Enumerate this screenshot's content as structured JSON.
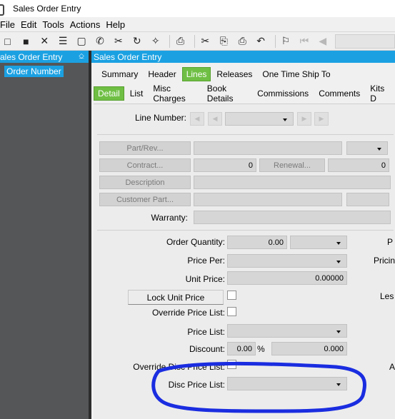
{
  "window": {
    "title": "Sales Order Entry"
  },
  "menu": [
    "File",
    "Edit",
    "Tools",
    "Actions",
    "Help"
  ],
  "toolbar": {
    "icons": [
      "new-icon",
      "save-icon",
      "delete-icon",
      "book-icon",
      "note-icon",
      "phone-icon",
      "attach-icon",
      "refresh-icon",
      "clear-icon",
      "print-icon",
      "cut-icon",
      "copy-icon",
      "paste-icon",
      "undo-icon",
      "binoculars-icon",
      "first-record-icon",
      "previous-record-icon"
    ],
    "glyphs": [
      "□",
      "■",
      "✕",
      "☰",
      "▢",
      "✆",
      "✂",
      "↻",
      "✧",
      "⎙",
      "✂",
      "⎘",
      "⎙",
      "↶",
      "⚐",
      "⏮",
      "◀"
    ]
  },
  "tree": {
    "header": "ales Order Entry",
    "pin": "⎐",
    "node": "Order Number"
  },
  "main": {
    "header": "Sales Order Entry",
    "tabs_top": [
      {
        "label": "Summary",
        "active": false
      },
      {
        "label": "Header",
        "active": false
      },
      {
        "label": "Lines",
        "active": true
      },
      {
        "label": "Releases",
        "active": false
      },
      {
        "label": "One Time Ship To",
        "active": false
      }
    ],
    "tabs_sub": [
      {
        "label": "Detail",
        "active": true
      },
      {
        "label": "List",
        "active": false
      },
      {
        "label": "Misc Charges",
        "active": false
      },
      {
        "label": "Book Details",
        "active": false
      },
      {
        "label": "Commissions",
        "active": false
      },
      {
        "label": "Comments",
        "active": false
      },
      {
        "label": "Kits D",
        "active": false
      }
    ]
  },
  "form": {
    "line_number_label": "Line Number:",
    "part_rev_btn": "Part/Rev...",
    "contract_btn": "Contract...",
    "contract_value": "0",
    "renewal_btn": "Renewal...",
    "renewal_value": "0",
    "description_btn": "Description",
    "customer_part_btn": "Customer Part...",
    "warranty_label": "Warranty:",
    "order_quantity_label": "Order Quantity:",
    "order_quantity_value": "0.00",
    "price_per_label": "Price Per:",
    "unit_price_label": "Unit Price:",
    "unit_price_value": "0.00000",
    "lock_unit_price_btn": "Lock Unit Price",
    "override_price_list_label": "Override Price List:",
    "price_list_label": "Price List:",
    "discount_label": "Discount:",
    "discount_percent_value": "0.00",
    "discount_percent_sign": "%",
    "discount_amount_value": "0.000",
    "override_disc_price_list_label": "Override Disc Price List:",
    "disc_price_list_label": "Disc Price List:",
    "right_edge_p": "P",
    "right_edge_pricin": "Pricin",
    "right_edge_les": "Les",
    "right_edge_a": "A"
  },
  "annotation_color": "#1a2de0"
}
